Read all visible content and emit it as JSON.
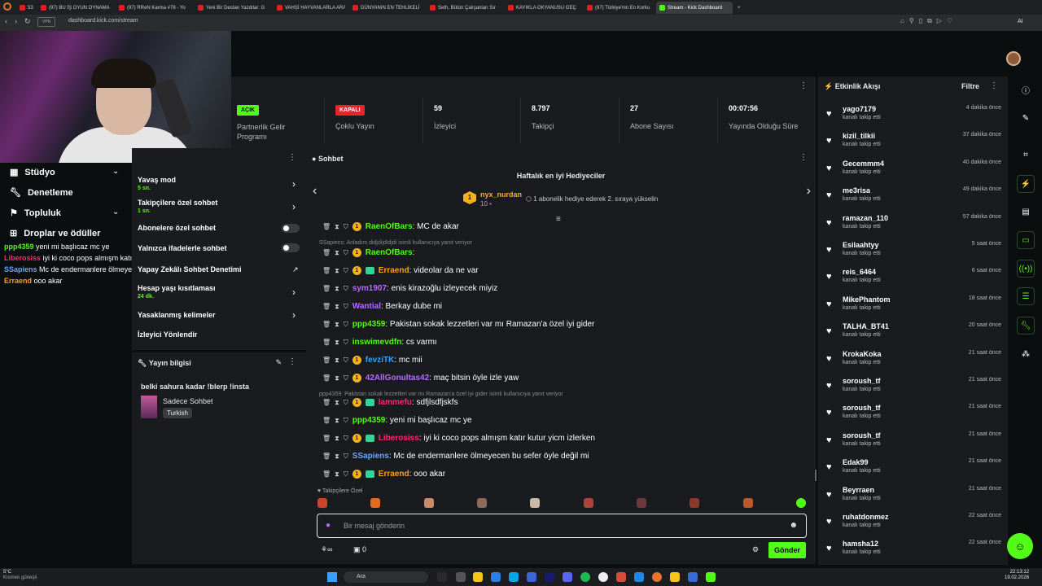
{
  "browser": {
    "tabs": [
      {
        "label": "53"
      },
      {
        "label": "(97) BU İŞ OYUN OYNAMA"
      },
      {
        "label": "(97) RReN Karma #78 - Yo"
      },
      {
        "label": "Yeni Bir Destan Yazdılar: G"
      },
      {
        "label": "VAHŞİ HAYVANLARLA ARA"
      },
      {
        "label": "DÜNYANIN EN TEHLİKELİ"
      },
      {
        "label": "Seth, Bütün Çalışanları Sır"
      },
      {
        "label": "KAYIKLA OKYANUSU GEÇ"
      },
      {
        "label": "(97) Türkiye'nin En Korku"
      },
      {
        "label": "Stream - Kick Dashboard"
      }
    ],
    "url": "dashboard.kick.com/stream",
    "ai_label": "AI"
  },
  "sidebar": {
    "items": [
      {
        "label": "Stüdyo"
      },
      {
        "label": "Denetleme"
      },
      {
        "label": "Topluluk"
      },
      {
        "label": "Droplar ve ödüller"
      }
    ],
    "overlay_chat": [
      {
        "user": "ppp4359",
        "text": "yeni mi başlıcaz mc ye",
        "color": "#53fc18"
      },
      {
        "user": "Liberosiss",
        "text": "iyi ki coco pops almışm katır kutur yicm izlerken",
        "color": "#ff2a6d"
      },
      {
        "user": "SSapiens",
        "text": "Mc de endermanlere ölmeyecen bu sefer öyle değil mi",
        "color": "#6aa7ff"
      },
      {
        "user": "Erraend",
        "text": "ooo akar",
        "color": "#ff9f1c"
      }
    ]
  },
  "stats": {
    "partner": {
      "badge": "AÇIK",
      "label": "Partnerlik Gelir Programı",
      "color": "#53fc18"
    },
    "multistream": {
      "badge": "KAPALI",
      "label": "Çoklu Yayın",
      "color": "#e5252a"
    },
    "viewers": {
      "value": "59",
      "label": "İzleyici"
    },
    "followers": {
      "value": "8.797",
      "label": "Takipçi"
    },
    "subs": {
      "value": "27",
      "label": "Abone Sayısı"
    },
    "uptime": {
      "value": "00:07:56",
      "label": "Yayında Olduğu Süre"
    }
  },
  "settings": {
    "rows": [
      {
        "label": "Yavaş mod",
        "sub": "5 sn."
      },
      {
        "label": "Takipçilere özel sohbet",
        "sub": "1 sn."
      },
      {
        "label": "Abonelere özel sohbet"
      },
      {
        "label": "Yalnızca ifadelerle sohbet"
      },
      {
        "label": "Yapay Zekâlı Sohbet Denetimi"
      },
      {
        "label": "Hesap yaşı kısıtlaması",
        "sub": "24 dk."
      },
      {
        "label": "Yasaklanmış kelimeler"
      },
      {
        "label": "İzleyici Yönlendir"
      }
    ]
  },
  "streaminfo": {
    "header": "Yayın bilgisi",
    "title": "belki sahura kadar !blerp !insta",
    "category": "Sadece Sohbet",
    "language": "Turkish"
  },
  "chat": {
    "header": "Sohbet",
    "gifters_title": "Haftalık en iyi Hediyeciler",
    "top_gifter": {
      "name": "nyx_nurdan",
      "count": "10"
    },
    "gift_hint": "1 abonelik hediye ederek 2. sıraya yükselin",
    "messages": [
      {
        "user": "RaenOfBars",
        "text": ": MC de akar",
        "color": "#53fc18",
        "sub": true
      },
      {
        "reply": "SSapiens: Anladım didjdijdidjdi isimli kullanıcıya yanıt veriyor"
      },
      {
        "user": "RaenOfBars",
        "text": ":",
        "color": "#53fc18",
        "sub": true
      },
      {
        "user": "Erraend",
        "text": ": videolar da ne var",
        "color": "#ff9f1c",
        "sub": true,
        "gift": true
      },
      {
        "user": "sym1907",
        "text": ": enis kirazoğlu izleyecek miyiz",
        "color": "#b86bff"
      },
      {
        "user": "Wantial",
        "text": ": Berkay dube mi",
        "color": "#b86bff"
      },
      {
        "user": "ppp4359",
        "text": ": Pakistan sokak lezzetleri var mı Ramazan'a özel iyi gider",
        "color": "#53fc18"
      },
      {
        "user": "inswimevdfn",
        "text": ": cs varmı",
        "color": "#53fc18"
      },
      {
        "user": "fevziTK",
        "text": ": mc mii",
        "color": "#3aa0ff",
        "sub": true
      },
      {
        "user": "42AllGonultas42",
        "text": ": maç bitsin öyle izle yaw",
        "color": "#b86bff",
        "sub": true
      },
      {
        "reply": "ppp4359: Pakistan sokak lezzetleri var mı Ramazan'a özel iyi gider isimli kullanıcıya yanıt veriyor"
      },
      {
        "user": "lammefu",
        "text": ": sdfjlsdfjskfs",
        "color": "#ff2a6d",
        "sub": true,
        "gift": true
      },
      {
        "user": "ppp4359",
        "text": ": yeni mi başlıcaz mc ye",
        "color": "#53fc18"
      },
      {
        "user": "Liberosiss",
        "text": ": iyi ki coco pops almışm katır kutur yicm izlerken",
        "color": "#ff2a6d",
        "sub": true,
        "gift": true
      },
      {
        "user": "SSapiens",
        "text": ": Mc de endermanlere ölmeyecen bu sefer öyle değil mi",
        "color": "#6aa7ff"
      },
      {
        "user": "Erraend",
        "text": ": ooo akar",
        "color": "#ff9f1c",
        "sub": true,
        "gift": true
      }
    ],
    "followers_only": "Takipçilere Özel",
    "input_placeholder": "Bir mesaj gönderin",
    "points": "0",
    "send_label": "Gönder"
  },
  "feed": {
    "header": "Etkinlik Akışı",
    "filter": "Filtre",
    "action": "kanalı takip etti",
    "items": [
      {
        "name": "yago7179",
        "time": "4 dakika önce"
      },
      {
        "name": "kizil_tilkii",
        "time": "37 dakika önce"
      },
      {
        "name": "Gecemmm4",
        "time": "40 dakika önce"
      },
      {
        "name": "me3risa",
        "time": "49 dakika önce"
      },
      {
        "name": "ramazan_110",
        "time": "57 dakika önce"
      },
      {
        "name": "Esilaahtyy",
        "time": "5 saat önce"
      },
      {
        "name": "reis_6464",
        "time": "6 saat önce"
      },
      {
        "name": "MikePhantom",
        "time": "18 saat önce"
      },
      {
        "name": "TALHA_BT41",
        "time": "20 saat önce"
      },
      {
        "name": "KrokaKoka",
        "time": "21 saat önce"
      },
      {
        "name": "soroush_tf",
        "time": "21 saat önce"
      },
      {
        "name": "soroush_tf",
        "time": "21 saat önce"
      },
      {
        "name": "soroush_tf",
        "time": "21 saat önce"
      },
      {
        "name": "Edak99",
        "time": "21 saat önce"
      },
      {
        "name": "Beyrraen",
        "time": "21 saat önce"
      },
      {
        "name": "ruhatdonmez",
        "time": "22 saat önce"
      },
      {
        "name": "hamsha12",
        "time": "22 saat önce"
      }
    ]
  },
  "taskbar": {
    "weather_temp": "5°C",
    "weather_desc": "Kısmen güneşli",
    "search": "Ara",
    "time": "22:13:12",
    "date": "19.02.2026"
  }
}
